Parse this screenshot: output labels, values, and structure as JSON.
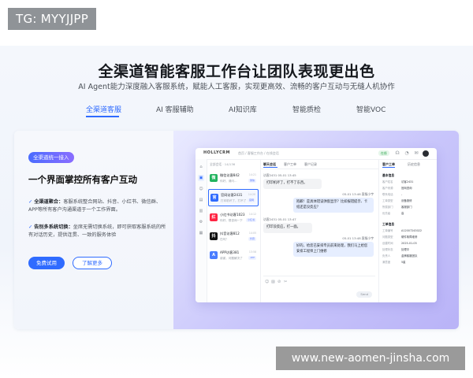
{
  "watermarks": {
    "top": "TG: MYYJJPP",
    "bottom": "www.new-aomen-jinsha.com"
  },
  "hero": {
    "title": "全渠道智能客服工作台让团队表现更出色",
    "subtitle": "AI Agent能力深度融入客服系统，赋能人工客服，实现更高效、流畅的客户互动与无缝人机协作"
  },
  "tabs": [
    {
      "label": "全渠道客服",
      "active": true
    },
    {
      "label": "AI 客服辅助",
      "active": false
    },
    {
      "label": "AI知识库",
      "active": false
    },
    {
      "label": "智能质检",
      "active": false
    },
    {
      "label": "智能VOC",
      "active": false
    }
  ],
  "feature": {
    "badge": "全渠道统一接入",
    "headline": "一个界面掌控所有客户互动",
    "points": [
      {
        "key": "全渠道聚合：",
        "text": "客服系统整合网站、抖音、小红书、微信群、APP等所有客户沟通渠道于一个工作界面。"
      },
      {
        "key": "告别多系统切换：",
        "text": "坐席无需切换系统，即可获取客服系统的所有对话历史，提供连贯、一致的服务体验"
      }
    ],
    "primary_button": "免费试用",
    "secondary_button": "了解更多"
  },
  "app": {
    "logo": "HOLLYCRM",
    "breadcrumb": "首页 / 客服工作台 / 在线会话",
    "live_badge": "在线",
    "list_header": "全部会话 · 14/136",
    "conversations": [
      {
        "name": "微信访客842",
        "msg": "你好，请问…",
        "time": "14:21",
        "tag": "微信",
        "color": "#22b35e",
        "glyph": "微",
        "selected": false
      },
      {
        "name": "官网访客2431",
        "msg": "打印机坏了，打不了",
        "time": "14:20",
        "tag": "官网",
        "color": "#2f6bff",
        "glyph": "官",
        "selected": true
      },
      {
        "name": "小红书访客1023",
        "msg": "你好，想咨询一下",
        "time": "14:12",
        "tag": "小红书",
        "color": "#ff2442",
        "glyph": "红",
        "selected": false
      },
      {
        "name": "抖音访客812",
        "msg": "在吗？",
        "time": "14:05",
        "tag": "抖音",
        "color": "#111111",
        "glyph": "抖",
        "selected": false
      },
      {
        "name": "APP访客381",
        "msg": "谢谢，问题解决了",
        "time": "13:58",
        "tag": "APP",
        "color": "#4a7dff",
        "glyph": "A",
        "selected": false
      }
    ],
    "chat_tabs": [
      "聊天会话",
      "客户工单",
      "客户记录"
    ],
    "messages": [
      {
        "side": "in",
        "meta": "访客2431  05-01 13:45",
        "text": "打印机坏了，打不了东西。"
      },
      {
        "side": "out",
        "meta": "05-01 13:46  客服小宇",
        "text": "抱歉！是具体错误弹窗显示？比如报错提示、卡纸还是没反应？"
      },
      {
        "side": "in",
        "meta": "访客2431  05-01 13:47",
        "text": "打印没反应，打一面。"
      },
      {
        "side": "out",
        "meta": "05-01 13:48  客服小宇",
        "text": "好的，给您已安排专员前来处理，我们马上给您安排工程师上门维修"
      }
    ],
    "composer": {
      "send_label": "Send"
    },
    "panel": {
      "tabs": [
        "客户工单",
        "历史信息"
      ],
      "section_basic": "基本信息",
      "basic": [
        {
          "k": "客户姓名",
          "v": "访客2431"
        },
        {
          "k": "客户来源",
          "v": "官网咨询"
        },
        {
          "k": "联系电话",
          "v": "-"
        },
        {
          "k": "工单类型",
          "v": "设备报修"
        },
        {
          "k": "所属部门",
          "v": "客服部门"
        },
        {
          "k": "优先级",
          "v": "高"
        }
      ],
      "section_order": "工单信息",
      "order": [
        {
          "k": "工单编号",
          "v": "A12007243022"
        },
        {
          "k": "问题类型",
          "v": "硬件故障维修"
        },
        {
          "k": "创建时间",
          "v": "2025-01-03"
        },
        {
          "k": "处理状态",
          "v": "处理中"
        },
        {
          "k": "负责人",
          "v": "金牌客服团队"
        },
        {
          "k": "满意度",
          "v": "5星"
        }
      ]
    }
  }
}
